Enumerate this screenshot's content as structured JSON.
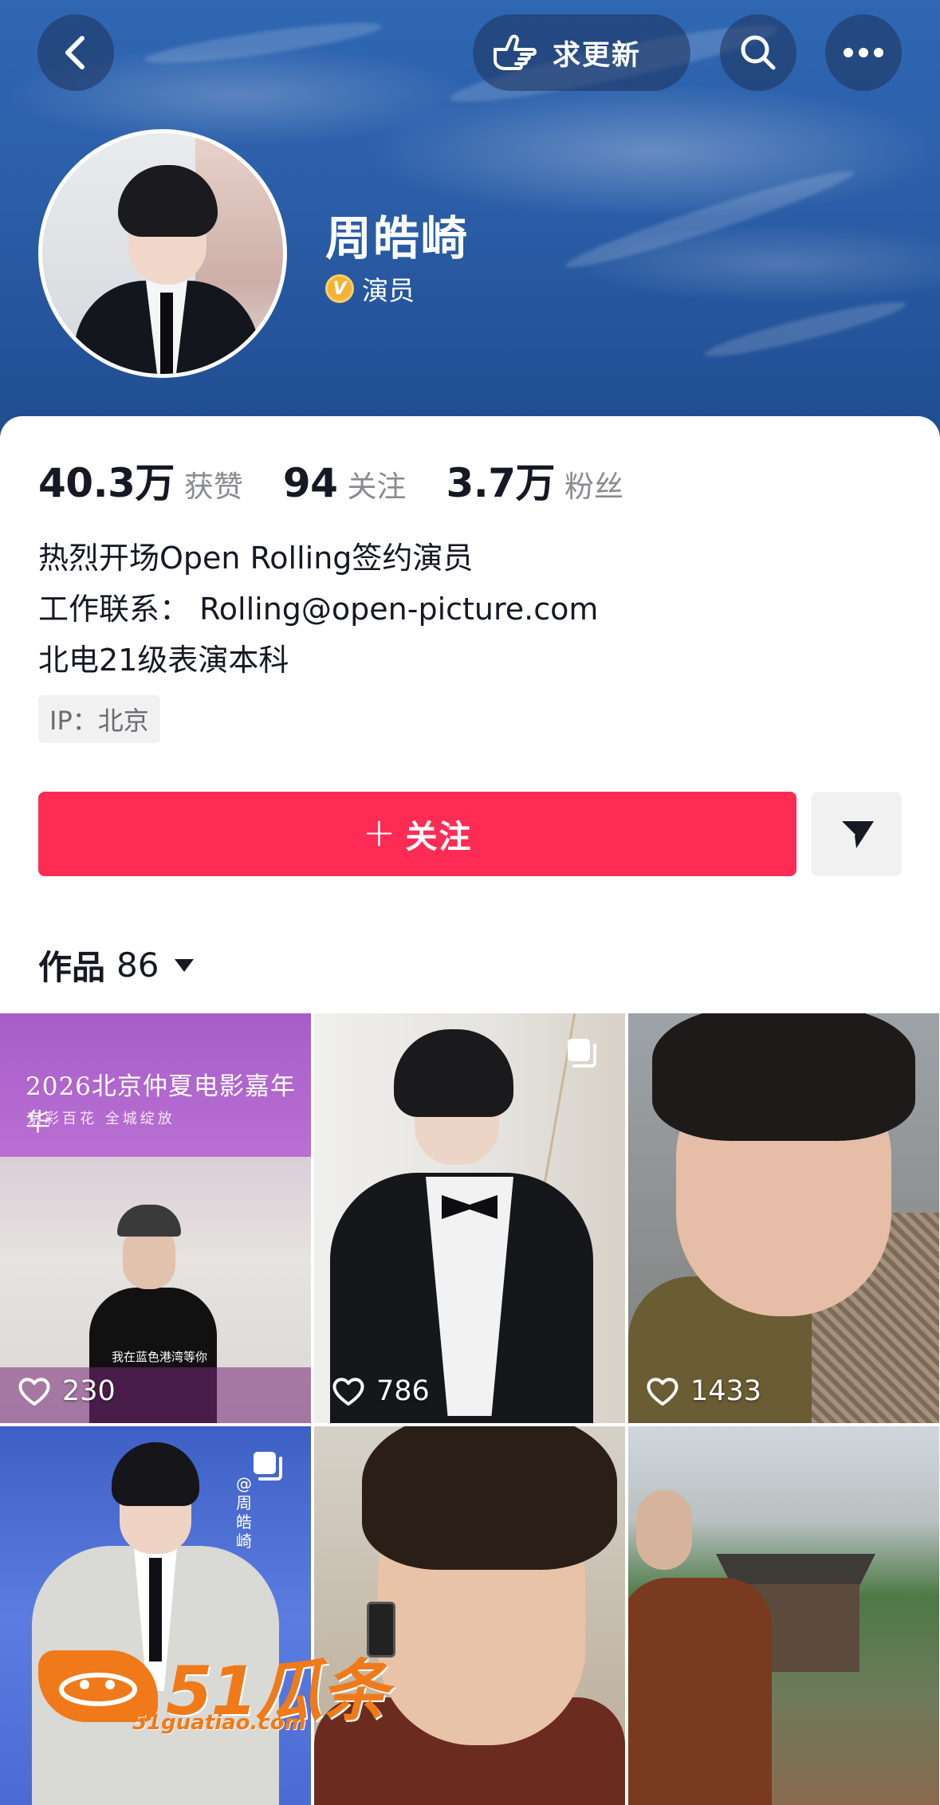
{
  "header": {
    "back_icon": "chevron-left-icon",
    "request_update_label": "求更新",
    "request_update_icon": "pointing-hand-icon",
    "search_icon": "search-icon",
    "more_icon": "more-dots-icon"
  },
  "profile": {
    "name": "周皓崎",
    "verified_badge": "V",
    "verified_title": "演员"
  },
  "stats": [
    {
      "value": "40.3万",
      "label": "获赞"
    },
    {
      "value": "94",
      "label": "关注"
    },
    {
      "value": "3.7万",
      "label": "粉丝"
    }
  ],
  "bio": {
    "line1": "热烈开场Open Rolling签约演员",
    "line2": "工作联系： Rolling@open-picture.com",
    "line3": "北电21级表演本科"
  },
  "ip_location": "IP：北京",
  "actions": {
    "follow_plus": "+",
    "follow_label": "关注",
    "share_icon": "send-arrow-icon"
  },
  "works": {
    "label": "作品",
    "count": "86"
  },
  "videos": [
    {
      "likes": "230",
      "promo_title": "2026北京仲夏电影嘉年华",
      "promo_sub": "京彩百花 全城绽放",
      "caption": "我在蓝色港湾等你",
      "multi": false
    },
    {
      "likes": "786",
      "multi": true
    },
    {
      "likes": "1433",
      "multi": false
    },
    {
      "likes": "",
      "side_text": "@周皓崎",
      "multi": true
    },
    {
      "likes": "",
      "multi": false
    },
    {
      "likes": "",
      "multi": false
    }
  ],
  "watermark": {
    "brand": "51瓜条",
    "url": "51guatiao.com"
  },
  "colors": {
    "accent": "#fe2c55",
    "verified": "#f4b338",
    "banner": "#2b5ea8"
  }
}
